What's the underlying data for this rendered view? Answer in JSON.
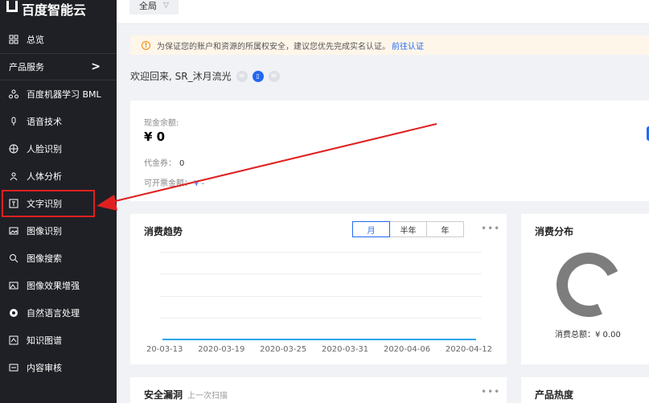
{
  "sidebar": {
    "logo_text": "百度智能云",
    "overview_label": "总览",
    "section_label": "产品服务",
    "section_chevron": ">",
    "items": [
      {
        "label": "百度机器学习 BML",
        "icon": "ml-icon"
      },
      {
        "label": "语音技术",
        "icon": "mic-icon"
      },
      {
        "label": "人脸识别",
        "icon": "face-icon"
      },
      {
        "label": "人体分析",
        "icon": "body-icon"
      },
      {
        "label": "文字识别",
        "icon": "text-icon"
      },
      {
        "label": "图像识别",
        "icon": "image-icon"
      },
      {
        "label": "图像搜索",
        "icon": "image-search-icon"
      },
      {
        "label": "图像效果增强",
        "icon": "image-enhance-icon"
      },
      {
        "label": "自然语言处理",
        "icon": "nlp-icon"
      },
      {
        "label": "知识图谱",
        "icon": "knowledge-graph-icon"
      },
      {
        "label": "内容审核",
        "icon": "content-review-icon"
      }
    ]
  },
  "topbar": {
    "region_label": "全局"
  },
  "notice": {
    "text": "为保证您的账户和资源的所属权安全，建议您优先完成实名认证。",
    "link_text": "前往认证"
  },
  "welcome": {
    "text": "欢迎回来, SR_沐月流光"
  },
  "balance": {
    "cash_label": "现金余额:",
    "cash_value": "¥ 0",
    "voucher_label": "代金券：",
    "voucher_value": "0",
    "invoice_label": "可开票金额：",
    "invoice_value": "¥ -"
  },
  "trend": {
    "title": "消费趋势",
    "ranges": [
      "月",
      "半年",
      "年"
    ],
    "active_range": "月",
    "more": "•••"
  },
  "chart_data": {
    "type": "line",
    "title": "消费趋势",
    "x": [
      "20-03-13",
      "2020-03-19",
      "2020-03-25",
      "2020-03-31",
      "2020-04-06",
      "2020-04-12"
    ],
    "values": [
      0,
      0,
      0,
      0,
      0,
      0
    ],
    "grid": true,
    "color": "#2aa6e8"
  },
  "distribution": {
    "title": "消费分布",
    "total_label": "消费总额：¥ 0.00"
  },
  "vulnerability": {
    "title": "安全漏洞",
    "subtitle": "上一次扫描",
    "more": "•••"
  },
  "heat": {
    "title": "产品热度"
  },
  "colors": {
    "sidebar_bg": "#1f2026",
    "accent": "#2468f2",
    "highlight": "#e02020"
  }
}
